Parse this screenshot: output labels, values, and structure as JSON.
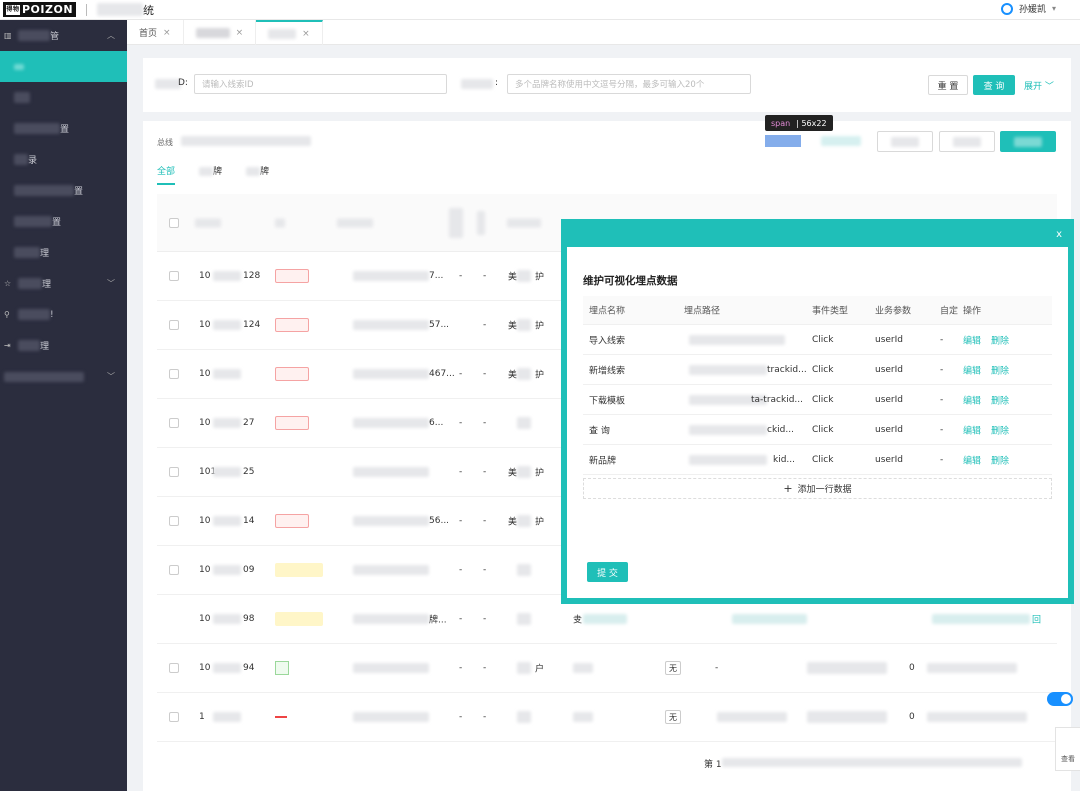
{
  "app": {
    "logo_small": "得物",
    "logo_text": "POIZON",
    "title_suffix": "统",
    "user_name": "孙媛凯"
  },
  "tabs": [
    {
      "label": "首页",
      "close": "×"
    },
    {
      "label": "",
      "close": "×"
    },
    {
      "label": "",
      "close": "×"
    }
  ],
  "filter": {
    "clue_label_suffix": "D:",
    "clue_placeholder": "请输入线索ID",
    "brand_label_suffix": ":",
    "brand_placeholder": "多个品牌名称使用中文逗号分隔，最多可输入20个",
    "reset": "重 置",
    "query": "查 询",
    "expand": "展开"
  },
  "content": {
    "summary_prefix": "总线",
    "sub_tabs": [
      "全部",
      "牌",
      "牌"
    ],
    "inspect": {
      "tag": "span",
      "size": "56x22"
    },
    "inspect_target_text": "下载模板",
    "pager_prefix": "第 1"
  },
  "table_rows": [
    {
      "id_start": "10",
      "id_end": "128",
      "tag": "red",
      "tail": "7...",
      "c1": "-",
      "c2": "-",
      "brand": "美",
      "cat": "护"
    },
    {
      "id_start": "10",
      "id_end": "124",
      "tag": "red",
      "tail": "57...",
      "c1": "",
      "c2": "-",
      "brand": "美",
      "cat": "护"
    },
    {
      "id_start": "10",
      "id_end": "",
      "tag": "red",
      "tail": "467...",
      "c1": "-",
      "c2": "-",
      "brand": "美",
      "cat": "护"
    },
    {
      "id_start": "10",
      "id_end": "27",
      "tag": "red",
      "tail": "6...",
      "c1": "-",
      "c2": "-",
      "brand": "",
      "cat": ""
    },
    {
      "id_start": "101",
      "id_end": "25",
      "tag": "",
      "tail": "",
      "c1": "-",
      "c2": "-",
      "brand": "美",
      "cat": "护"
    },
    {
      "id_start": "10",
      "id_end": "14",
      "tag": "red",
      "tail": "56...",
      "c1": "-",
      "c2": "-",
      "brand": "美",
      "cat": "护"
    },
    {
      "id_start": "10",
      "id_end": "09",
      "tag": "yellow",
      "tail": "",
      "c1": "-",
      "c2": "-",
      "brand": "",
      "cat": ""
    },
    {
      "id_start": "10",
      "id_end": "98",
      "tag": "yellow",
      "tail": "牌...",
      "c1": "-",
      "c2": "-",
      "brand": "",
      "cat": ""
    },
    {
      "id_start": "10",
      "id_end": "94",
      "tag": "green",
      "tail": "",
      "c1": "-",
      "c2": "-",
      "brand": "",
      "cat": "户"
    },
    {
      "id_start": "1",
      "id_end": "",
      "tag": "line",
      "tail": "",
      "c1": "-",
      "c2": "-",
      "brand": "",
      "cat": ""
    }
  ],
  "table_extra": {
    "row8_c7": "叏",
    "row8_link": "回",
    "none_label": "无",
    "dash": "-",
    "zero": "0"
  },
  "modal": {
    "close": "x",
    "title": "维护可视化埋点数据",
    "columns": [
      "埋点名称",
      "埋点路径",
      "事件类型",
      "业务参数",
      "自定",
      "操作"
    ],
    "rows": [
      {
        "name": "导入线索",
        "path": "",
        "event": "Click",
        "param": "userId",
        "custom": "-",
        "edit": "编辑",
        "del": "删除"
      },
      {
        "name": "新增线索",
        "path": "trackid...",
        "event": "Click",
        "param": "userId",
        "custom": "-",
        "edit": "编辑",
        "del": "删除"
      },
      {
        "name": "下载模板",
        "path": "ta-trackid...",
        "event": "Click",
        "param": "userId",
        "custom": "-",
        "edit": "编辑",
        "del": "删除"
      },
      {
        "name": "查 询",
        "path": "ckid...",
        "event": "Click",
        "param": "userId",
        "custom": "-",
        "edit": "编辑",
        "del": "删除"
      },
      {
        "name": "新品牌",
        "path": "kid...",
        "event": "Click",
        "param": "userId",
        "custom": "-",
        "edit": "编辑",
        "del": "删除"
      }
    ],
    "add_row": "添加一行数据",
    "add_icon": "+",
    "submit": "提 交"
  },
  "sidebar": {
    "items": [
      {
        "label": "管",
        "kind": "group",
        "icon": "chart-icon"
      },
      {
        "label": "",
        "kind": "active"
      },
      {
        "label": "",
        "kind": "item"
      },
      {
        "label": "置",
        "kind": "item"
      },
      {
        "label": "录",
        "kind": "item"
      },
      {
        "label": "置",
        "kind": "item"
      },
      {
        "label": "置",
        "kind": "item"
      },
      {
        "label": "理",
        "kind": "item"
      },
      {
        "label": "理",
        "kind": "group",
        "icon": "star-icon"
      },
      {
        "label": "!",
        "kind": "group",
        "icon": "pin-icon"
      },
      {
        "label": "理",
        "kind": "group",
        "icon": "login-icon"
      },
      {
        "label": "",
        "kind": "group"
      }
    ]
  },
  "float_card": {
    "label": "查看"
  }
}
